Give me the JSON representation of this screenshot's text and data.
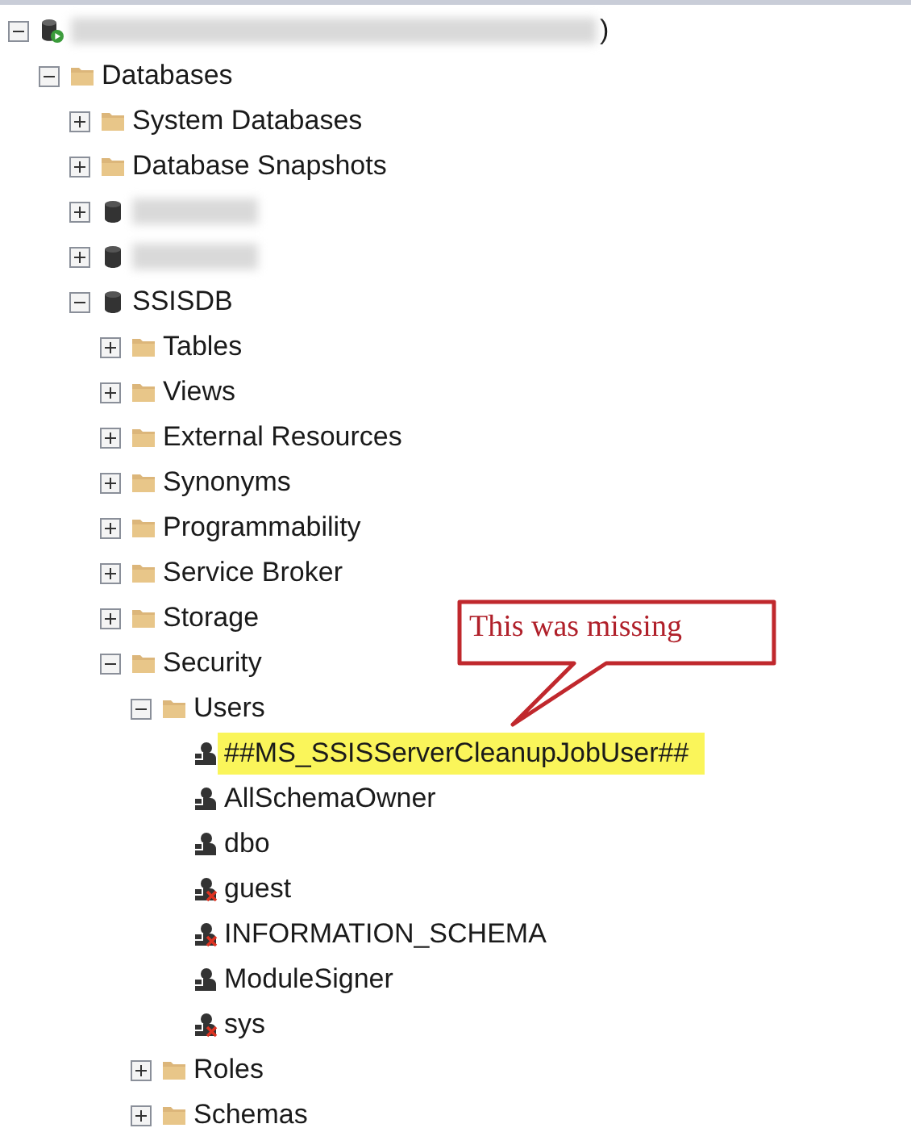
{
  "tree": [
    {
      "kind": "server",
      "label": ")",
      "redacted": true,
      "expanded": true,
      "children": [
        {
          "kind": "folder",
          "label": "Databases",
          "expanded": true,
          "children": [
            {
              "kind": "folder",
              "label": "System Databases",
              "expanded": false
            },
            {
              "kind": "folder",
              "label": "Database Snapshots",
              "expanded": false
            },
            {
              "kind": "database",
              "redacted": true,
              "expanded": false
            },
            {
              "kind": "database",
              "redacted": true,
              "expanded": false
            },
            {
              "kind": "database",
              "label": "SSISDB",
              "expanded": true,
              "children": [
                {
                  "kind": "folder",
                  "label": "Tables",
                  "expanded": false
                },
                {
                  "kind": "folder",
                  "label": "Views",
                  "expanded": false
                },
                {
                  "kind": "folder",
                  "label": "External Resources",
                  "expanded": false
                },
                {
                  "kind": "folder",
                  "label": "Synonyms",
                  "expanded": false
                },
                {
                  "kind": "folder",
                  "label": "Programmability",
                  "expanded": false
                },
                {
                  "kind": "folder",
                  "label": "Service Broker",
                  "expanded": false
                },
                {
                  "kind": "folder",
                  "label": "Storage",
                  "expanded": false
                },
                {
                  "kind": "folder",
                  "label": "Security",
                  "expanded": true,
                  "children": [
                    {
                      "kind": "folder",
                      "label": "Users",
                      "expanded": true,
                      "children": [
                        {
                          "kind": "user",
                          "label": "##MS_SSISServerCleanupJobUser##",
                          "highlighted": true
                        },
                        {
                          "kind": "user",
                          "label": "AllSchemaOwner",
                          "highlighted": false
                        },
                        {
                          "kind": "user",
                          "label": "dbo",
                          "highlighted": false
                        },
                        {
                          "kind": "user-disabled",
                          "label": "guest",
                          "highlighted": false
                        },
                        {
                          "kind": "user-disabled",
                          "label": "INFORMATION_SCHEMA",
                          "highlighted": false
                        },
                        {
                          "kind": "user",
                          "label": "ModuleSigner",
                          "highlighted": false
                        },
                        {
                          "kind": "user-disabled",
                          "label": "sys",
                          "highlighted": false
                        }
                      ]
                    },
                    {
                      "kind": "folder",
                      "label": "Roles",
                      "expanded": false
                    },
                    {
                      "kind": "folder",
                      "label": "Schemas",
                      "expanded": false
                    }
                  ]
                }
              ]
            }
          ]
        }
      ]
    }
  ],
  "callout": {
    "text": "This was missing"
  }
}
